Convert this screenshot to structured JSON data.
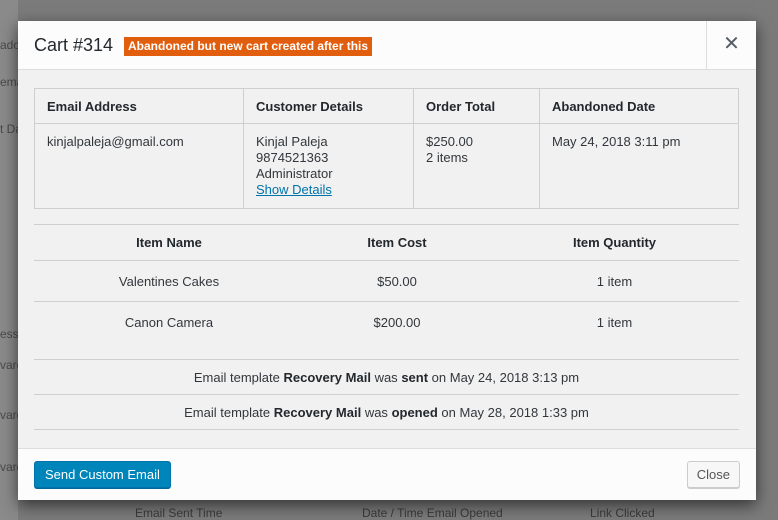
{
  "background": {
    "fragments": [
      "ado",
      "ema",
      "t Da",
      "ess",
      "vare",
      "vare",
      "vare"
    ],
    "bottom_headers": [
      "Email Sent Time",
      "Date / Time Email Opened",
      "Link Clicked"
    ]
  },
  "modal": {
    "title": "Cart #314",
    "badge": "Abandoned but new cart created after this",
    "close_icon": "close-icon"
  },
  "details": {
    "headers": [
      "Email Address",
      "Customer Details",
      "Order Total",
      "Abandoned Date"
    ],
    "email": "kinjalpaleja@gmail.com",
    "customer": {
      "name": "Kinjal Paleja",
      "phone": "9874521363",
      "role": "Administrator",
      "link": "Show Details"
    },
    "order": {
      "total": "$250.00",
      "items": "2 items"
    },
    "abandoned_date": "May 24, 2018 3:11 pm"
  },
  "items": {
    "headers": [
      "Item Name",
      "Item Cost",
      "Item Quantity"
    ],
    "rows": [
      {
        "name": "Valentines Cakes",
        "cost": "$50.00",
        "qty": "1 item"
      },
      {
        "name": "Canon Camera",
        "cost": "$200.00",
        "qty": "1 item"
      }
    ]
  },
  "log": [
    {
      "prefix": "Email template",
      "template": "Recovery Mail",
      "mid": "was",
      "action": "sent",
      "suffix": "on May 24, 2018 3:13 pm"
    },
    {
      "prefix": "Email template",
      "template": "Recovery Mail",
      "mid": "was",
      "action": "opened",
      "suffix": "on May 28, 2018 1:33 pm"
    }
  ],
  "footer": {
    "send_label": "Send Custom Email",
    "close_label": "Close"
  },
  "colors": {
    "badge": "#e25e0f",
    "primary": "#0085ba",
    "link": "#0073aa"
  }
}
